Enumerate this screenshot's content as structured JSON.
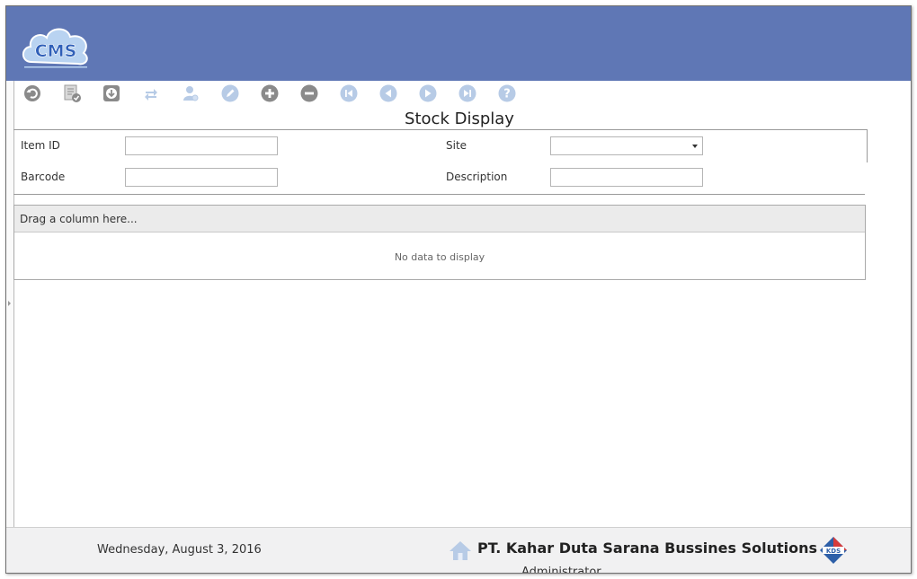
{
  "header": {
    "logo_text": "CMS",
    "brand_color": "#5f77b5"
  },
  "toolbar": {
    "buttons": [
      {
        "name": "undo-icon",
        "enabled": true
      },
      {
        "name": "document-check-icon",
        "enabled": true
      },
      {
        "name": "download-icon",
        "enabled": true
      },
      {
        "name": "refresh-icon",
        "enabled": false
      },
      {
        "name": "user-settings-icon",
        "enabled": false
      },
      {
        "name": "edit-icon",
        "enabled": false
      },
      {
        "name": "add-icon",
        "enabled": true
      },
      {
        "name": "remove-icon",
        "enabled": true
      },
      {
        "name": "first-record-icon",
        "enabled": false
      },
      {
        "name": "previous-record-icon",
        "enabled": false
      },
      {
        "name": "next-record-icon",
        "enabled": false
      },
      {
        "name": "last-record-icon",
        "enabled": false
      },
      {
        "name": "help-icon",
        "enabled": false
      }
    ]
  },
  "page": {
    "title": "Stock Display"
  },
  "filters": {
    "item_id": {
      "label": "Item ID",
      "value": ""
    },
    "barcode": {
      "label": "Barcode",
      "value": ""
    },
    "site": {
      "label": "Site",
      "value": ""
    },
    "description": {
      "label": "Description",
      "value": ""
    }
  },
  "grid": {
    "group_panel_text": "Drag a column here...",
    "empty_text": "No data to display"
  },
  "footer": {
    "date": "Wednesday, August 3, 2016",
    "company": "PT. Kahar Duta Sarana Bussines Solutions",
    "company_logo_text": "KDS",
    "user": "Administrator"
  }
}
